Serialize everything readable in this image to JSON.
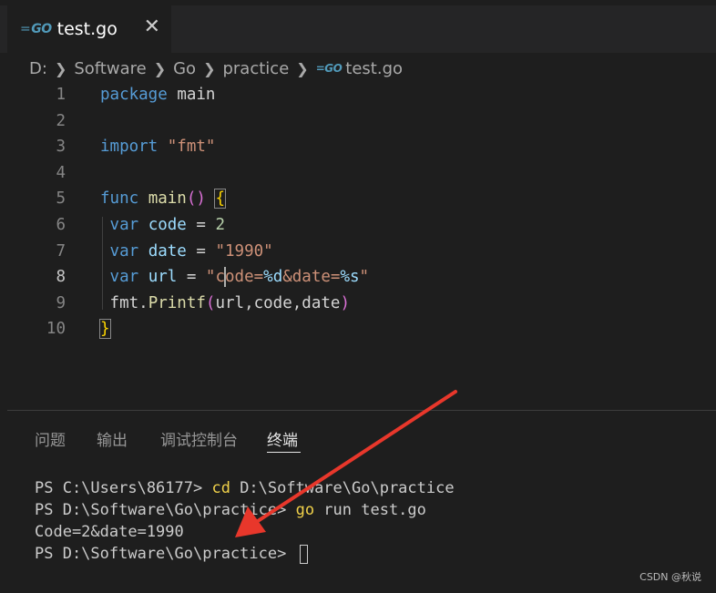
{
  "tab": {
    "icon": "go-file-icon",
    "title": "test.go",
    "close": "✕"
  },
  "breadcrumb": [
    "D:",
    "Software",
    "Go",
    "practice",
    "test.go"
  ],
  "editor": {
    "active_line": 8,
    "line_numbers": [
      "1",
      "2",
      "3",
      "4",
      "5",
      "6",
      "7",
      "8",
      "9",
      "10"
    ]
  },
  "panel": {
    "tabs": [
      "问题",
      "输出",
      "调试控制台",
      "终端"
    ],
    "active_tab": "终端"
  },
  "terminal": {
    "lines": [
      {
        "prompt": "PS C:\\Users\\86177> ",
        "command": "cd D:\\Software\\Go\\practice"
      },
      {
        "prompt": "PS D:\\Software\\Go\\practice> ",
        "command": "go run test.go"
      },
      {
        "prompt": "Code=2&date=1990",
        "command": ""
      },
      {
        "prompt": "PS D:\\Software\\Go\\practice> ",
        "command": ""
      }
    ]
  },
  "watermark": "CSDN @秋说",
  "colors": {
    "arrow": "#e8372b",
    "keyword": "#569cd6",
    "string": "#ce9178",
    "background": "#1e1e1e"
  }
}
